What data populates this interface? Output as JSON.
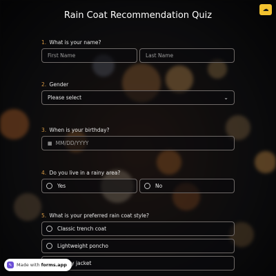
{
  "title": "Rain Coat Recommendation Quiz",
  "top_button": {
    "icon": "cloud-icon"
  },
  "questions": {
    "q1": {
      "num": "1.",
      "label": "What is your name?",
      "first_placeholder": "First Name",
      "last_placeholder": "Last Name"
    },
    "q2": {
      "num": "2.",
      "label": "Gender",
      "value": "Please select"
    },
    "q3": {
      "num": "3.",
      "label": "When is your birthday?",
      "placeholder": "MM/DD/YYYY"
    },
    "q4": {
      "num": "4.",
      "label": "Do you live in a rainy area?",
      "options": [
        "Yes",
        "No"
      ]
    },
    "q5": {
      "num": "5.",
      "label": "What is your preferred rain coat style?",
      "options": [
        "Classic trench coat",
        "Lightweight poncho",
        "Sporty jacket"
      ]
    }
  },
  "badge": {
    "prefix": "Made with",
    "brand": "forms.app"
  },
  "colors": {
    "accent": "#d89a44",
    "badge_logo": "#6b4fd6",
    "top_button": "#f2c230"
  }
}
